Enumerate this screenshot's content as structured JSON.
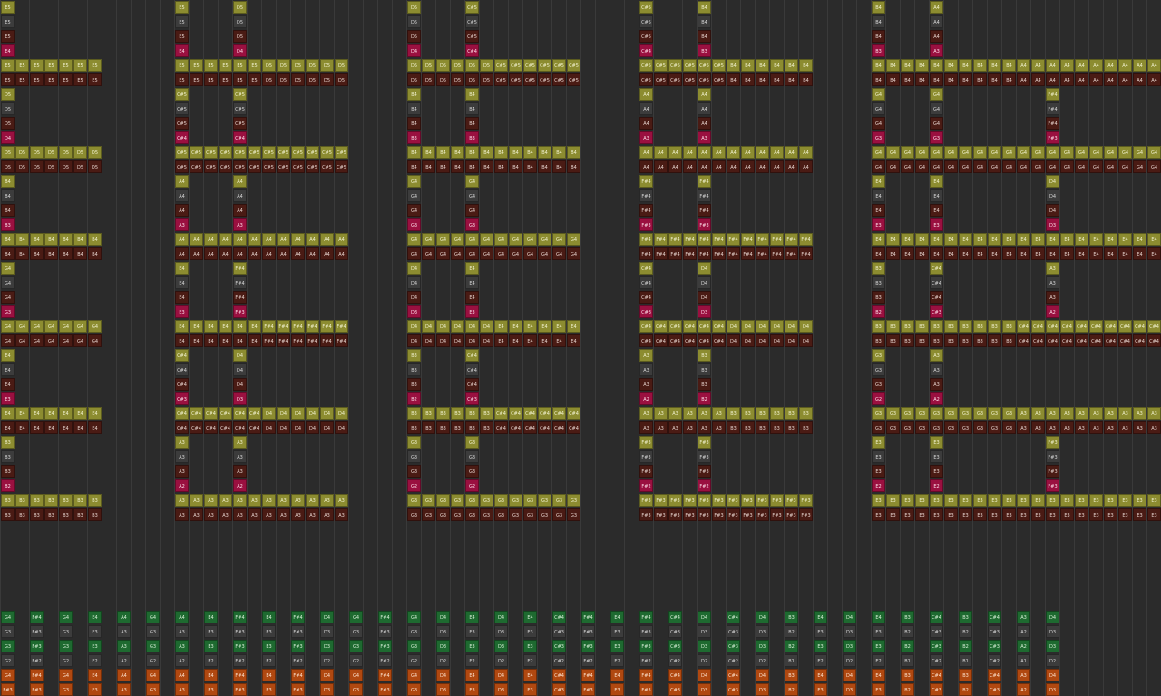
{
  "note_colors": {
    "olive": {
      "bg": "#8c8c30",
      "fg": "#f2f2d0"
    },
    "maroon": {
      "bg": "#4a1b14",
      "fg": "#e8d6d0"
    },
    "gray": {
      "bg": "#3c3c3c",
      "fg": "#d8d8d8"
    },
    "crimson": {
      "bg": "#9a1040",
      "fg": "#ffe0ea"
    },
    "green": {
      "bg": "#1e6a30",
      "fg": "#d8f0d8"
    },
    "orange": {
      "bg": "#b04810",
      "fg": "#ffe4d0"
    }
  },
  "blocks": [
    {
      "column": 0,
      "row": 0,
      "repeats": 7,
      "tops": [
        [
          "E5",
          "E5",
          "E5",
          "E4"
        ],
        [
          "D5",
          "D5",
          "D5",
          "D4"
        ],
        [
          "B4",
          "B4",
          "B4",
          "B3"
        ],
        [
          "G4",
          "G4",
          "G4",
          "G3"
        ],
        [
          "E4",
          "E4",
          "E4",
          "E3"
        ],
        [
          "B3",
          "B3",
          "B3",
          "B2"
        ]
      ],
      "rows": [
        [
          "E5",
          "E5"
        ],
        [
          "D5",
          "D5"
        ],
        [
          "B4",
          "B4"
        ],
        [
          "G4",
          "G4"
        ],
        [
          "E4",
          "E4"
        ],
        [
          "B3",
          "B3"
        ]
      ]
    },
    {
      "column": 12,
      "row": 0,
      "repeats": 12,
      "tops": [
        [
          "E5",
          "E5",
          "E5",
          "E4",
          "D5",
          "D5",
          "D5",
          "D4"
        ],
        [
          "C#5",
          "C#5",
          "C#5",
          "C#4",
          "C#5",
          "C#5",
          "C#5",
          "C#4"
        ],
        [
          "A4",
          "A4",
          "A4",
          "A3",
          "A4",
          "A4",
          "A4",
          "A3"
        ],
        [
          "E4",
          "E4",
          "E4",
          "E3",
          "F#4",
          "F#4",
          "F#4",
          "F#3"
        ],
        [
          "C#4",
          "C#4",
          "C#4",
          "C#3",
          "D4",
          "D4",
          "D4",
          "D3"
        ],
        [
          "A3",
          "A3",
          "A3",
          "A2",
          "A3",
          "A3",
          "A3",
          "A2"
        ]
      ],
      "rows": [
        [
          "E5",
          "D5"
        ],
        [
          "C#5",
          "C#5"
        ],
        [
          "A4",
          "A4"
        ],
        [
          "E4",
          "F#4"
        ],
        [
          "C#4",
          "D4"
        ],
        [
          "A3",
          "A3"
        ]
      ]
    },
    {
      "column": 28,
      "row": 0,
      "repeats": 12,
      "tops": [
        [
          "D5",
          "D5",
          "D5",
          "D4",
          "C#5",
          "C#5",
          "C#5",
          "C#4"
        ],
        [
          "B4",
          "B4",
          "B4",
          "B3",
          "B4",
          "B4",
          "B4",
          "B3"
        ],
        [
          "G4",
          "G4",
          "G4",
          "G3",
          "G4",
          "G4",
          "G4",
          "G3"
        ],
        [
          "D4",
          "D4",
          "D4",
          "D3",
          "E4",
          "E4",
          "E4",
          "E3"
        ],
        [
          "B3",
          "B3",
          "B3",
          "B2",
          "C#4",
          "C#4",
          "C#4",
          "C#3"
        ],
        [
          "G3",
          "G3",
          "G3",
          "G2",
          "G3",
          "G3",
          "G3",
          "G2"
        ]
      ],
      "rows": [
        [
          "D5",
          "C#5"
        ],
        [
          "B4",
          "B4"
        ],
        [
          "G4",
          "G4"
        ],
        [
          "D4",
          "E4"
        ],
        [
          "B3",
          "C#4"
        ],
        [
          "G3",
          "G3"
        ]
      ]
    },
    {
      "column": 44,
      "row": 0,
      "repeats": 12,
      "tops": [
        [
          "C#5",
          "C#5",
          "C#5",
          "C#4",
          "B4",
          "B4",
          "B4",
          "B3"
        ],
        [
          "A4",
          "A4",
          "A4",
          "A3",
          "A4",
          "A4",
          "A4",
          "A3"
        ],
        [
          "F#4",
          "F#4",
          "F#4",
          "F#3",
          "F#4",
          "F#4",
          "F#4",
          "F#3"
        ],
        [
          "C#4",
          "C#4",
          "C#4",
          "C#3",
          "D4",
          "D4",
          "D4",
          "D3"
        ],
        [
          "A3",
          "A3",
          "A3",
          "A2",
          "B3",
          "B3",
          "B3",
          "B2"
        ],
        [
          "F#3",
          "F#3",
          "F#3",
          "F#2",
          "F#3",
          "F#3",
          "F#3",
          "F#2"
        ]
      ],
      "rows": [
        [
          "C#5",
          "B4"
        ],
        [
          "A4",
          "A4"
        ],
        [
          "F#4",
          "F#4"
        ],
        [
          "C#4",
          "D4"
        ],
        [
          "A3",
          "B3"
        ],
        [
          "F#3",
          "F#3"
        ]
      ]
    },
    {
      "column": 60,
      "row": 0,
      "repeats": 20,
      "tops": [
        [
          "B4",
          "B4",
          "B4",
          "B3",
          "A4",
          "A4",
          "A4",
          "A3"
        ],
        [
          "G4",
          "G4",
          "G4",
          "G3",
          "G4",
          "G4",
          "G4",
          "G3"
        ],
        [
          "E4",
          "E4",
          "E4",
          "E3",
          "E4",
          "E4",
          "E4",
          "E3"
        ],
        [
          "B3",
          "B3",
          "B3",
          "B2",
          "C#4",
          "C#4",
          "C#4",
          "C#3"
        ],
        [
          "G3",
          "G3",
          "G3",
          "G2",
          "A3",
          "A3",
          "A3",
          "A2"
        ],
        [
          "E3",
          "E3",
          "E3",
          "E2",
          "E3",
          "E3",
          "E3",
          "E2"
        ]
      ],
      "rows": [
        [
          "B4",
          "A4"
        ],
        [
          "G4",
          "G4"
        ],
        [
          "E4",
          "E4"
        ],
        [
          "B3",
          "C#4"
        ],
        [
          "G3",
          "A3"
        ],
        [
          "E3",
          "E3"
        ]
      ]
    }
  ],
  "extra_columns": [
    {
      "column": 72,
      "row": 6,
      "notes": [
        "F#4",
        "F#4",
        "F#4",
        "F#3"
      ]
    },
    {
      "column": 72,
      "row": 12,
      "notes": [
        "D4",
        "D4",
        "D4",
        "D3"
      ]
    },
    {
      "column": 72,
      "row": 18,
      "notes": [
        "A3",
        "A3",
        "A3",
        "A2"
      ]
    },
    {
      "column": 72,
      "row": 30,
      "notes": [
        "F#3",
        "F#3",
        "F#3",
        "F#3"
      ]
    }
  ],
  "bass": {
    "row1": [
      "G4",
      "F#4",
      "G4",
      "E4",
      "A4",
      "G4",
      "A4",
      "E4",
      "F#4",
      "E4",
      "F#4",
      "D4",
      "G4",
      "F#4",
      "G4",
      "D4",
      "E4",
      "D4",
      "E4",
      "C#4",
      "F#4",
      "E4",
      "F#4",
      "C#4",
      "D4",
      "C#4",
      "D4",
      "B3",
      "E4",
      "D4",
      "E4",
      "B3",
      "C#4",
      "B3",
      "C#4",
      "A3",
      "D4"
    ],
    "row2": [
      "G3",
      "F#3",
      "G3",
      "E3",
      "A3",
      "G3",
      "A3",
      "E3",
      "F#3",
      "E3",
      "F#3",
      "D3",
      "G3",
      "F#3",
      "G3",
      "D3",
      "E3",
      "D3",
      "E3",
      "C#3",
      "F#3",
      "E3",
      "F#3",
      "C#3",
      "D3",
      "C#3",
      "D3",
      "B2",
      "E3",
      "D3",
      "E3",
      "B2",
      "C#3",
      "B2",
      "C#3",
      "A2",
      "D3"
    ],
    "row3": [
      "G3",
      "F#3",
      "G3",
      "E3",
      "A3",
      "G3",
      "A3",
      "E3",
      "F#3",
      "E3",
      "F#3",
      "D3",
      "G3",
      "F#3",
      "G3",
      "D3",
      "E3",
      "D3",
      "E3",
      "C#3",
      "F#3",
      "E3",
      "F#3",
      "C#3",
      "D3",
      "C#3",
      "D3",
      "B2",
      "E3",
      "D3",
      "E3",
      "B2",
      "C#3",
      "B2",
      "C#3",
      "A2",
      "D3"
    ],
    "row4": [
      "G2",
      "F#2",
      "G2",
      "E2",
      "A2",
      "G2",
      "A2",
      "E2",
      "F#2",
      "E2",
      "F#2",
      "D2",
      "G2",
      "F#2",
      "G2",
      "D2",
      "E2",
      "D2",
      "E2",
      "C#2",
      "F#2",
      "E2",
      "F#2",
      "C#2",
      "D2",
      "C#2",
      "D2",
      "B1",
      "E2",
      "D2",
      "E2",
      "B1",
      "C#2",
      "B1",
      "C#2",
      "A1",
      "D2"
    ],
    "row5": [
      "G4",
      "F#4",
      "G4",
      "E4",
      "A4",
      "G4",
      "A4",
      "E4",
      "F#4",
      "E4",
      "F#4",
      "D4",
      "G4",
      "F#4",
      "G4",
      "D4",
      "E4",
      "D4",
      "E4",
      "C#4",
      "F#4",
      "E4",
      "F#4",
      "C#4",
      "D4",
      "C#4",
      "D4",
      "B3",
      "E4",
      "D4",
      "E4",
      "B3",
      "C#4",
      "B3",
      "C#4",
      "A3",
      "D4"
    ],
    "row6": [
      "F#3",
      "F#3",
      "G3",
      "E3",
      "A3",
      "G3",
      "A3",
      "E3",
      "F#3",
      "E3",
      "F#3",
      "D3",
      "G3",
      "F#3",
      "G3",
      "D3",
      "E3",
      "D3",
      "E3",
      "C#3",
      "F#3",
      "E3",
      "F#3",
      "C#3",
      "D3",
      "C#3",
      "D3",
      "B2",
      "E3",
      "D3",
      "E3",
      "B2",
      "C#3",
      "B2",
      "C#3",
      "A2",
      "D3"
    ]
  }
}
